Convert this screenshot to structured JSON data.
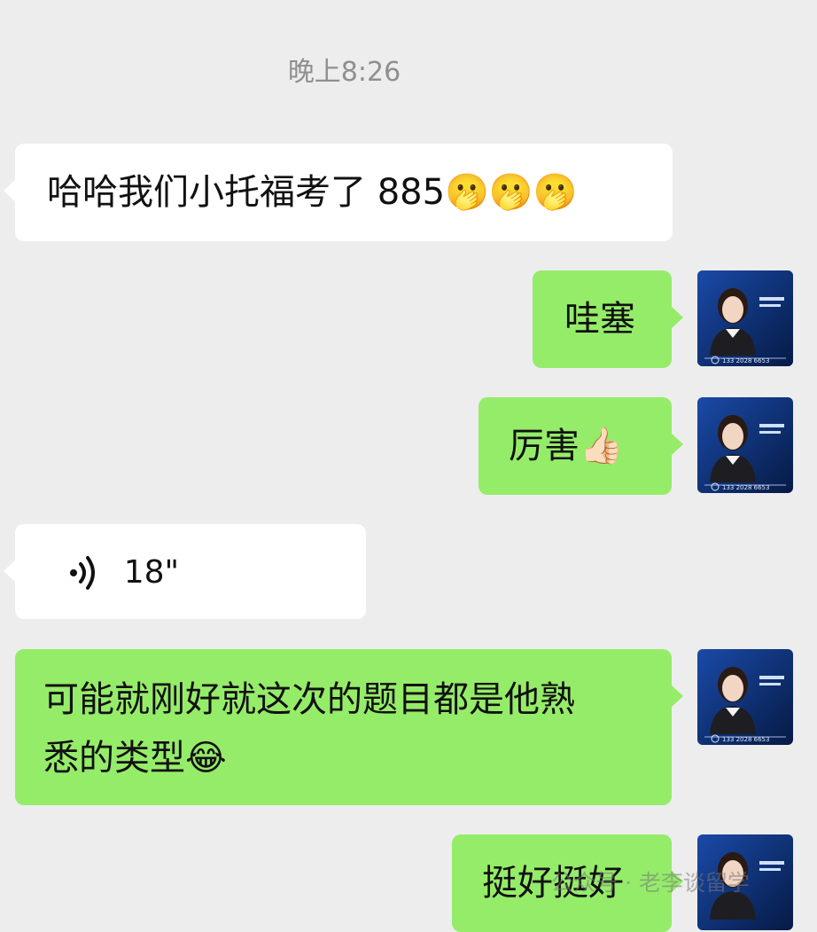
{
  "timestamp": "晚上8:26",
  "messages": [
    {
      "side": "in",
      "text": "哈哈我们小托福考了 885",
      "emoji": "🫢🫢🫢"
    },
    {
      "side": "out",
      "text": "哇塞"
    },
    {
      "side": "out",
      "text": "厉害",
      "emoji": "👍🏻"
    },
    {
      "side": "in",
      "type": "voice",
      "duration": "18\""
    },
    {
      "side": "out",
      "line1": "可能就刚好就这次的题目都是他熟",
      "line2": "悉的类型",
      "emoji": "😂"
    },
    {
      "side": "out",
      "text": "挺好挺好"
    }
  ],
  "avatar": {
    "phone": "133 2028 6653",
    "badge_line1": "让老师",
    "badge_line2": "教您英语"
  },
  "watermark": "公众号 · 老李谈留学",
  "colors": {
    "background": "#ededed",
    "incoming_bubble": "#ffffff",
    "outgoing_bubble": "#95ec69",
    "avatar_bg": "#0b2a6b"
  }
}
